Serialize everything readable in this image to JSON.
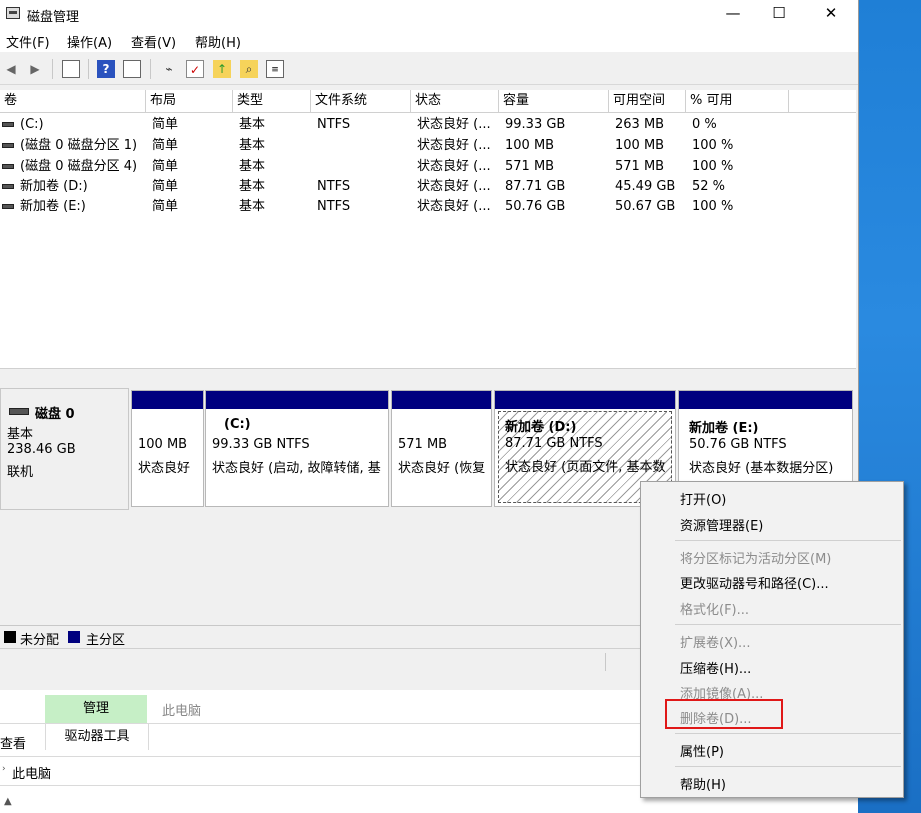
{
  "window": {
    "title": "磁盘管理",
    "min": "—",
    "max": "☐",
    "close": "✕"
  },
  "menu": [
    "文件(F)",
    "操作(A)",
    "查看(V)",
    "帮助(H)"
  ],
  "toolbar_icons": [
    "back-arrow-icon",
    "forward-arrow-icon",
    "show-hide-pane-icon",
    "help-icon",
    "properties-pane-icon",
    "connect-icon",
    "checklist-icon",
    "rescan-icon",
    "search-disk-icon",
    "list-view-icon"
  ],
  "columns": [
    "卷",
    "布局",
    "类型",
    "文件系统",
    "状态",
    "容量",
    "可用空间",
    "% 可用"
  ],
  "volumes": [
    {
      "name": "(C:)",
      "layout": "简单",
      "type": "基本",
      "fs": "NTFS",
      "status": "状态良好 (...",
      "capacity": "99.33 GB",
      "free": "263 MB",
      "pct": "0 %"
    },
    {
      "name": "(磁盘 0 磁盘分区 1)",
      "layout": "简单",
      "type": "基本",
      "fs": "",
      "status": "状态良好 (...",
      "capacity": "100 MB",
      "free": "100 MB",
      "pct": "100 %"
    },
    {
      "name": "(磁盘 0 磁盘分区 4)",
      "layout": "简单",
      "type": "基本",
      "fs": "",
      "status": "状态良好 (...",
      "capacity": "571 MB",
      "free": "571 MB",
      "pct": "100 %"
    },
    {
      "name": "新加卷 (D:)",
      "layout": "简单",
      "type": "基本",
      "fs": "NTFS",
      "status": "状态良好 (...",
      "capacity": "87.71 GB",
      "free": "45.49 GB",
      "pct": "52 %"
    },
    {
      "name": "新加卷 (E:)",
      "layout": "简单",
      "type": "基本",
      "fs": "NTFS",
      "status": "状态良好 (...",
      "capacity": "50.76 GB",
      "free": "50.67 GB",
      "pct": "100 %"
    }
  ],
  "disk": {
    "name": "磁盘 0",
    "type": "基本",
    "size": "238.46 GB",
    "state": "联机"
  },
  "partitions": [
    {
      "title": "",
      "size": "100 MB",
      "status": "状态良好"
    },
    {
      "title": "(C:)",
      "size": "99.33 GB NTFS",
      "status": "状态良好 (启动, 故障转储, 基"
    },
    {
      "title": "",
      "size": "571 MB",
      "status": "状态良好 (恢复"
    },
    {
      "title": "新加卷 (D:)",
      "size": "87.71 GB NTFS",
      "status": "状态良好 (页面文件, 基本数"
    },
    {
      "title": "新加卷 (E:)",
      "size": "50.76 GB NTFS",
      "status": "状态良好 (基本数据分区)"
    }
  ],
  "legend": [
    {
      "label": "未分配",
      "color": "#000000"
    },
    {
      "label": "主分区",
      "color": "#00007f"
    }
  ],
  "explorer": {
    "tab_manage": "管理",
    "tab_pc": "此电脑",
    "view": "查看",
    "drive_tools": "驱动器工具",
    "address": "此电脑"
  },
  "context_menu": {
    "open": "打开(O)",
    "explorer": "资源管理器(E)",
    "mark_active": "将分区标记为活动分区(M)",
    "change_letter": "更改驱动器号和路径(C)...",
    "format": "格式化(F)...",
    "extend": "扩展卷(X)...",
    "shrink": "压缩卷(H)...",
    "add_mirror": "添加镜像(A)...",
    "delete": "删除卷(D)...",
    "properties": "属性(P)",
    "help": "帮助(H)"
  },
  "colors": {
    "primary_partition": "#00007f",
    "highlight_box": "#e01818",
    "manage_tab": "#c6efc6"
  }
}
